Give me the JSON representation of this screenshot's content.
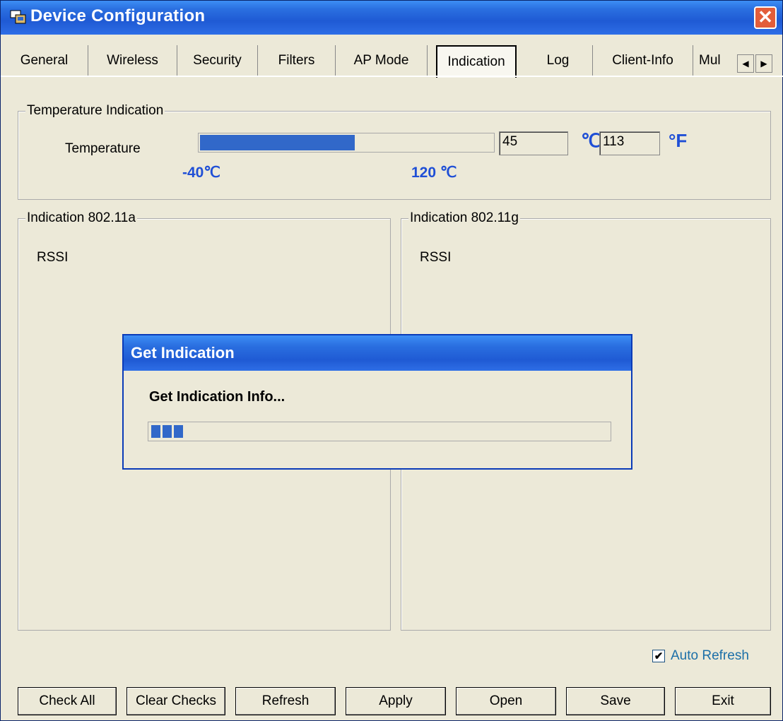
{
  "window": {
    "title": "Device Configuration",
    "close_glyph": "✕"
  },
  "tabs": [
    "General",
    "Wireless",
    "Security",
    "Filters",
    "AP Mode",
    "Indication",
    "Log",
    "Client-Info",
    "Mul"
  ],
  "active_tab": "Indication",
  "temperature": {
    "group_label": "Temperature Indication",
    "label": "Temperature",
    "min_label": "-40℃",
    "max_label": "120 ℃",
    "celsius_value": "45",
    "fahrenheit_value": "113",
    "celsius_unit": "℃",
    "fahrenheit_unit": "°F",
    "bar_fraction": 0.53
  },
  "indication_a": {
    "group_label": "Indication 802.11a",
    "rssi_label": "RSSI"
  },
  "indication_g": {
    "group_label": "Indication 802.11g",
    "rssi_label": "RSSI"
  },
  "auto_refresh": {
    "label": "Auto Refresh",
    "checked": true
  },
  "buttons": [
    "Check All",
    "Clear Checks",
    "Refresh",
    "Apply",
    "Open",
    "Save",
    "Exit"
  ],
  "dialog": {
    "title": "Get Indication",
    "message": "Get Indication Info...",
    "progress_segments": 3
  },
  "colors": {
    "accent": "#1f4fd6",
    "progress": "#3168c9",
    "titlebar": "#2a6fe0"
  }
}
